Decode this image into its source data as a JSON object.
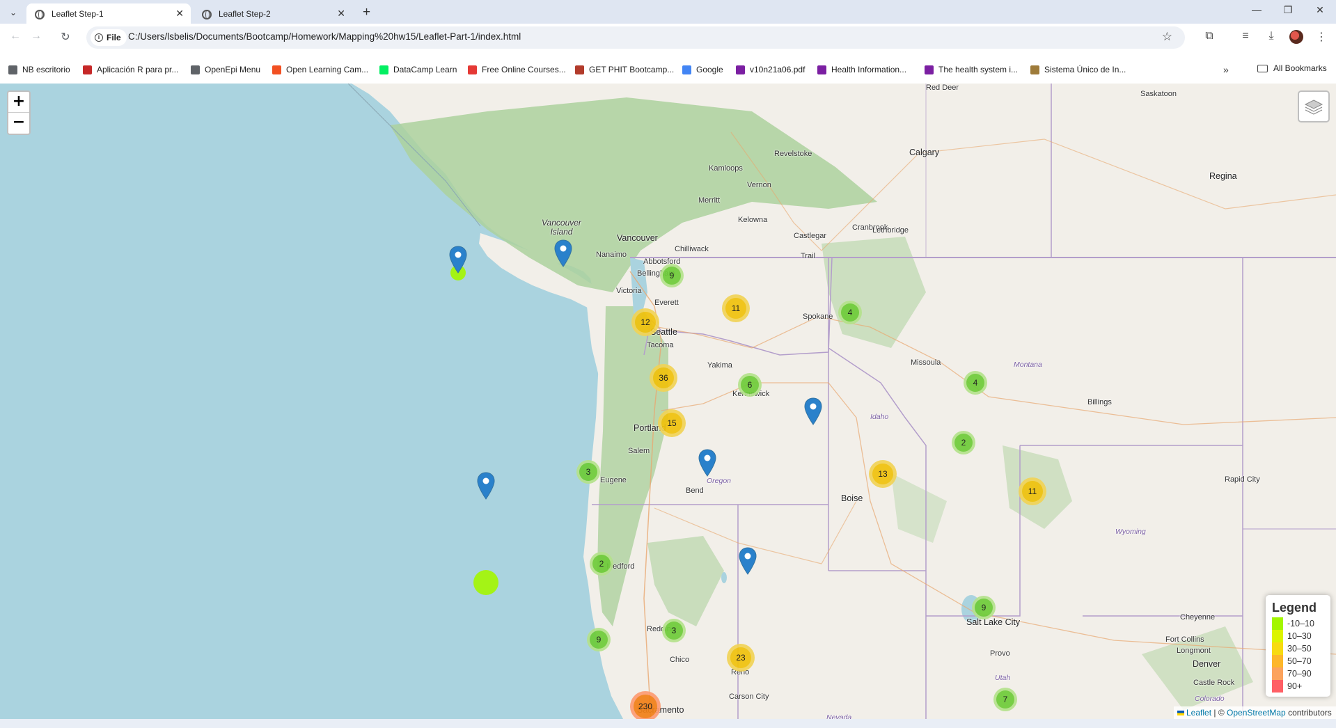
{
  "browser": {
    "tabs": [
      {
        "title": "Leaflet Step-1",
        "active": true
      },
      {
        "title": "Leaflet Step-2",
        "active": false
      }
    ],
    "address": {
      "scheme_chip": "File",
      "url": "C:/Users/lsbelis/Documents/Bootcamp/Homework/Mapping%20hw15/Leaflet-Part-1/index.html"
    },
    "bookmarks": [
      {
        "label": "NB escritorio",
        "icon_color": "#5f6368"
      },
      {
        "label": "Aplicación R para pr...",
        "icon_color": "#c62828"
      },
      {
        "label": "OpenEpi Menu",
        "icon_color": "#5f6368"
      },
      {
        "label": "Open Learning Cam...",
        "icon_color": "#f25022"
      },
      {
        "label": "DataCamp Learn",
        "icon_color": "#03ef62"
      },
      {
        "label": "Free Online Courses...",
        "icon_color": "#e53935"
      },
      {
        "label": "GET PHIT Bootcamp...",
        "icon_color": "#b23b2b"
      },
      {
        "label": "Google",
        "icon_color": "#4285f4"
      },
      {
        "label": "v10n21a06.pdf",
        "icon_color": "#7b1fa2"
      },
      {
        "label": "Health Information...",
        "icon_color": "#7b1fa2"
      },
      {
        "label": "The health system i...",
        "icon_color": "#7b1fa2"
      },
      {
        "label": "Sistema Único de In...",
        "icon_color": "#9e7b3a"
      }
    ],
    "all_bookmarks_label": "All Bookmarks"
  },
  "map": {
    "zoom_in_label": "+",
    "zoom_out_label": "−",
    "places": [
      {
        "name": "Red Deer",
        "kind": "town"
      },
      {
        "name": "Saskatoon",
        "kind": "town"
      },
      {
        "name": "Calgary",
        "kind": "city"
      },
      {
        "name": "Regina",
        "kind": "city"
      },
      {
        "name": "Revelstoke",
        "kind": "town"
      },
      {
        "name": "Kamloops",
        "kind": "town"
      },
      {
        "name": "Vernon",
        "kind": "town"
      },
      {
        "name": "Merritt",
        "kind": "town"
      },
      {
        "name": "Kelowna",
        "kind": "town"
      },
      {
        "name": "Castlegar",
        "kind": "town"
      },
      {
        "name": "Cranbrook",
        "kind": "town"
      },
      {
        "name": "Lethbridge",
        "kind": "town"
      },
      {
        "name": "Vancouver",
        "kind": "city"
      },
      {
        "name": "Nanaimo",
        "kind": "town"
      },
      {
        "name": "Chilliwack",
        "kind": "town"
      },
      {
        "name": "Abbotsford",
        "kind": "town"
      },
      {
        "name": "Trail",
        "kind": "town"
      },
      {
        "name": "Bellingham",
        "kind": "town"
      },
      {
        "name": "Victoria",
        "kind": "town"
      },
      {
        "name": "Everett",
        "kind": "town"
      },
      {
        "name": "Seattle",
        "kind": "city"
      },
      {
        "name": "Tacoma",
        "kind": "town"
      },
      {
        "name": "Spokane",
        "kind": "town"
      },
      {
        "name": "Yakima",
        "kind": "town"
      },
      {
        "name": "Kennewick",
        "kind": "town"
      },
      {
        "name": "Missoula",
        "kind": "town"
      },
      {
        "name": "Billings",
        "kind": "town"
      },
      {
        "name": "Portland",
        "kind": "city"
      },
      {
        "name": "Salem",
        "kind": "town"
      },
      {
        "name": "Eugene",
        "kind": "town"
      },
      {
        "name": "Bend",
        "kind": "town"
      },
      {
        "name": "Boise",
        "kind": "city"
      },
      {
        "name": "Medford",
        "kind": "town"
      },
      {
        "name": "Rapid City",
        "kind": "town"
      },
      {
        "name": "Redding",
        "kind": "town"
      },
      {
        "name": "Chico",
        "kind": "town"
      },
      {
        "name": "Reno",
        "kind": "town"
      },
      {
        "name": "Carson City",
        "kind": "town"
      },
      {
        "name": "Sacramento",
        "kind": "city"
      },
      {
        "name": "Salt Lake City",
        "kind": "city"
      },
      {
        "name": "Provo",
        "kind": "town"
      },
      {
        "name": "Cheyenne",
        "kind": "town"
      },
      {
        "name": "Fort Collins",
        "kind": "town"
      },
      {
        "name": "Longmont",
        "kind": "town"
      },
      {
        "name": "Denver",
        "kind": "city"
      },
      {
        "name": "Castle Rock",
        "kind": "town"
      },
      {
        "name": "Colorado",
        "kind": "state"
      },
      {
        "name": "Montana",
        "kind": "state"
      },
      {
        "name": "Idaho",
        "kind": "state"
      },
      {
        "name": "Oregon",
        "kind": "state"
      },
      {
        "name": "Wyoming",
        "kind": "state"
      },
      {
        "name": "Utah",
        "kind": "state"
      },
      {
        "name": "Nevada",
        "kind": "state"
      },
      {
        "name": "Vancouver Island",
        "kind": "island"
      }
    ],
    "clusters": [
      {
        "count": "9",
        "level": "small"
      },
      {
        "count": "11",
        "level": "medium"
      },
      {
        "count": "4",
        "level": "small"
      },
      {
        "count": "12",
        "level": "medium"
      },
      {
        "count": "36",
        "level": "medium"
      },
      {
        "count": "6",
        "level": "small"
      },
      {
        "count": "4",
        "level": "small"
      },
      {
        "count": "15",
        "level": "medium"
      },
      {
        "count": "2",
        "level": "small"
      },
      {
        "count": "3",
        "level": "small"
      },
      {
        "count": "13",
        "level": "medium"
      },
      {
        "count": "11",
        "level": "medium"
      },
      {
        "count": "2",
        "level": "small"
      },
      {
        "count": "9",
        "level": "small"
      },
      {
        "count": "3",
        "level": "small"
      },
      {
        "count": "23",
        "level": "medium"
      },
      {
        "count": "9",
        "level": "small"
      },
      {
        "count": "7",
        "level": "small"
      },
      {
        "count": "230",
        "level": "large"
      }
    ],
    "legend": {
      "title": "Legend",
      "items": [
        {
          "label": "-10–10",
          "color": "#a3f600"
        },
        {
          "label": "10–30",
          "color": "#dcf400"
        },
        {
          "label": "30–50",
          "color": "#f7db11"
        },
        {
          "label": "50–70",
          "color": "#fdb72a"
        },
        {
          "label": "70–90",
          "color": "#fca35d"
        },
        {
          "label": "90+",
          "color": "#ff5f65"
        }
      ]
    },
    "attribution": {
      "leaflet": "Leaflet",
      "separator": "| ©",
      "osm": "OpenStreetMap",
      "suffix": "contributors"
    }
  },
  "colors": {
    "water": "#aad3df",
    "land": "#f2efe9",
    "forest": "#add19e",
    "cluster_small": "#b5e28c",
    "cluster_small_inner": "#6ecc39",
    "cluster_medium": "#f1d357",
    "cluster_medium_inner": "#f0c20c",
    "cluster_large": "#fd9c73",
    "cluster_large_inner": "#f18017",
    "marker": "#2a81cb"
  }
}
